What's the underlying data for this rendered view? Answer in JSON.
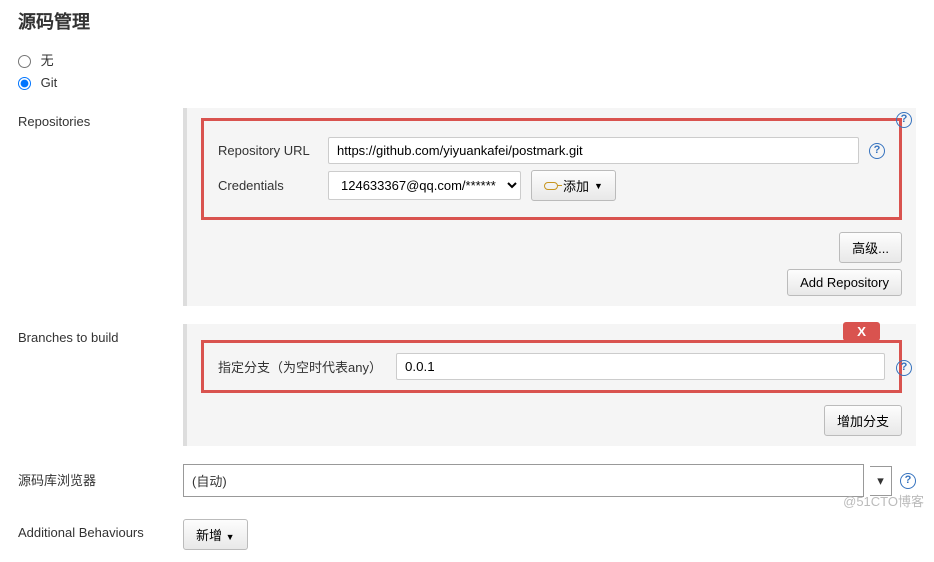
{
  "title": "源码管理",
  "scm": {
    "none_label": "无",
    "git_label": "Git"
  },
  "repositories": {
    "section_label": "Repositories",
    "url_label": "Repository URL",
    "url_value": "https://github.com/yiyuankafei/postmark.git",
    "cred_label": "Credentials",
    "cred_selected": "124633367@qq.com/******",
    "add_label": "添加",
    "advanced_label": "高级...",
    "add_repo_label": "Add Repository"
  },
  "branches": {
    "section_label": "Branches to build",
    "specifier_label": "指定分支（为空时代表any）",
    "specifier_value": "0.0.1",
    "delete_label": "X",
    "add_branch_label": "增加分支"
  },
  "browser": {
    "section_label": "源码库浏览器",
    "value": "(自动)"
  },
  "behaviours": {
    "section_label": "Additional Behaviours",
    "add_label": "新增"
  },
  "watermark": "@51CTO博客"
}
